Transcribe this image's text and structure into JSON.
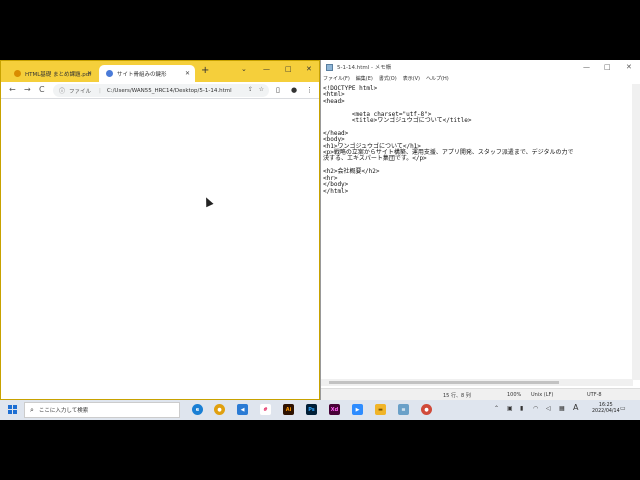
{
  "browser": {
    "tabs": [
      {
        "label": "HTML基礎 まとめ課題.pdf",
        "active": false,
        "favicon_color": "#d98c00"
      },
      {
        "label": "サイト骨組みの鍵形",
        "active": true,
        "favicon_color": "#4a7bd8"
      }
    ],
    "new_tab": "+",
    "window_buttons": {
      "minimize": "—",
      "maximize": "□",
      "close": "✕"
    },
    "address": {
      "scheme": "ファイル",
      "url": "C:/Users/WAN55_HRC14/Desktop/5-1-14.html"
    },
    "nav": {
      "back": "←",
      "forward": "→",
      "reload": "C"
    }
  },
  "notepad": {
    "title": "5-1-14.html - メモ帳",
    "menu": [
      "ファイル(F)",
      "編集(E)",
      "書式(O)",
      "表示(V)",
      "ヘルプ(H)"
    ],
    "window_buttons": {
      "minimize": "—",
      "maximize": "□",
      "close": "✕"
    },
    "content": "<!DOCTYPE html>\n<html>\n<head>\n\n        <meta charset=\"utf-8\">\n        <title>ワンゴジュウゴについて</title>\n\n</head>\n<body>\n<h1>ワンゴジュウゴについて</h1>\n<p>戦略の立案からサイト構築、運用支援、アプリ開発、スタッフ派遣まで、デジタルの力で\n決する、エキスパート集団です。</p>\n\n<h2>会社概要</h2>\n<hr>\n</body>\n</html>",
    "status": {
      "position": "15 行、8 列",
      "zoom": "100%",
      "eol": "Unix (LF)",
      "encoding": "UTF-8"
    }
  },
  "taskbar": {
    "search_placeholder": "ここに入力して検索",
    "apps": [
      {
        "name": "edge",
        "color": "#1a7fd4",
        "glyph": "e"
      },
      {
        "name": "chrome",
        "color": "#e0a010",
        "glyph": "●"
      },
      {
        "name": "vscode",
        "color": "#2b7bd4",
        "glyph": "◀"
      },
      {
        "name": "slack",
        "color": "#ffffff",
        "glyph": "#"
      },
      {
        "name": "illustrator",
        "color": "#2e1200",
        "glyph": "Ai"
      },
      {
        "name": "photoshop",
        "color": "#001e36",
        "glyph": "Ps"
      },
      {
        "name": "xd",
        "color": "#470137",
        "glyph": "Xd"
      },
      {
        "name": "zoom",
        "color": "#2d8cff",
        "glyph": "▶"
      },
      {
        "name": "explorer",
        "color": "#f0b429",
        "glyph": "▬"
      },
      {
        "name": "notepad",
        "color": "#6aa0c8",
        "glyph": "≡"
      },
      {
        "name": "chrome-active",
        "color": "#d04a3a",
        "glyph": "●"
      }
    ],
    "ime": "A",
    "time": "16:25",
    "date": "2022/04/14"
  }
}
